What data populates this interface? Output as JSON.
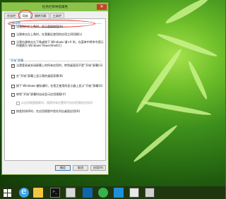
{
  "window": {
    "title": "任务栏和导航属性",
    "close_glyph": "✕"
  },
  "tabs": [
    {
      "label": "任务栏",
      "active": false
    },
    {
      "label": "导航",
      "active": true
    },
    {
      "label": "跳转列表",
      "active": false
    },
    {
      "label": "工具栏",
      "active": false
    }
  ],
  "corner_nav": {
    "heading": "边角导航",
    "options": [
      {
        "label": "当我指向右上角时，显示超级按钮(H)",
        "checked": true
      },
      {
        "label": "当我单击左上角时，在我最近使用的应用之间切换(L)",
        "checked": true
      },
      {
        "label": "当我右键单击左下角或按下 Windows 键+X 时，在菜单中将命令提示符替换为 Windows PowerShell(C)",
        "checked": false
      }
    ]
  },
  "start_screen": {
    "heading": "“开始”屏幕",
    "options": [
      {
        "label": "当我登录或关闭屏幕上的所有应用时，转到桌面而不是“开始”屏幕(G)",
        "checked": true,
        "indent": false,
        "disabled": false
      },
      {
        "label": "在“开始”屏幕上显示我的桌面背景(B)",
        "checked": false,
        "indent": false,
        "disabled": false
      },
      {
        "label": "按下 Windows 徽标键时，在我正使用的显示器上显示“开始”屏幕(S)",
        "checked": false,
        "indent": false,
        "disabled": false
      },
      {
        "label": "转到“开始”屏幕时自动显示应用视图(V)",
        "checked": false,
        "indent": false,
        "disabled": false
      },
      {
        "label": "从应用视图搜索时，搜索所有位置而不仅仅是我的应用(E)",
        "checked": false,
        "indent": true,
        "disabled": true
      },
      {
        "label": "按类别排序时，在应用视图中首先列出桌面应用(D)",
        "checked": false,
        "indent": false,
        "disabled": false
      }
    ]
  },
  "buttons": {
    "ok": "确定",
    "cancel": "取消",
    "apply": "应用(A)"
  },
  "taskbar": {
    "items": [
      "start-button",
      "internet-explorer",
      "file-explorer",
      "command-prompt",
      "app-4",
      "app-5",
      "app-6",
      "app-7",
      "app-8",
      "app-9"
    ]
  }
}
